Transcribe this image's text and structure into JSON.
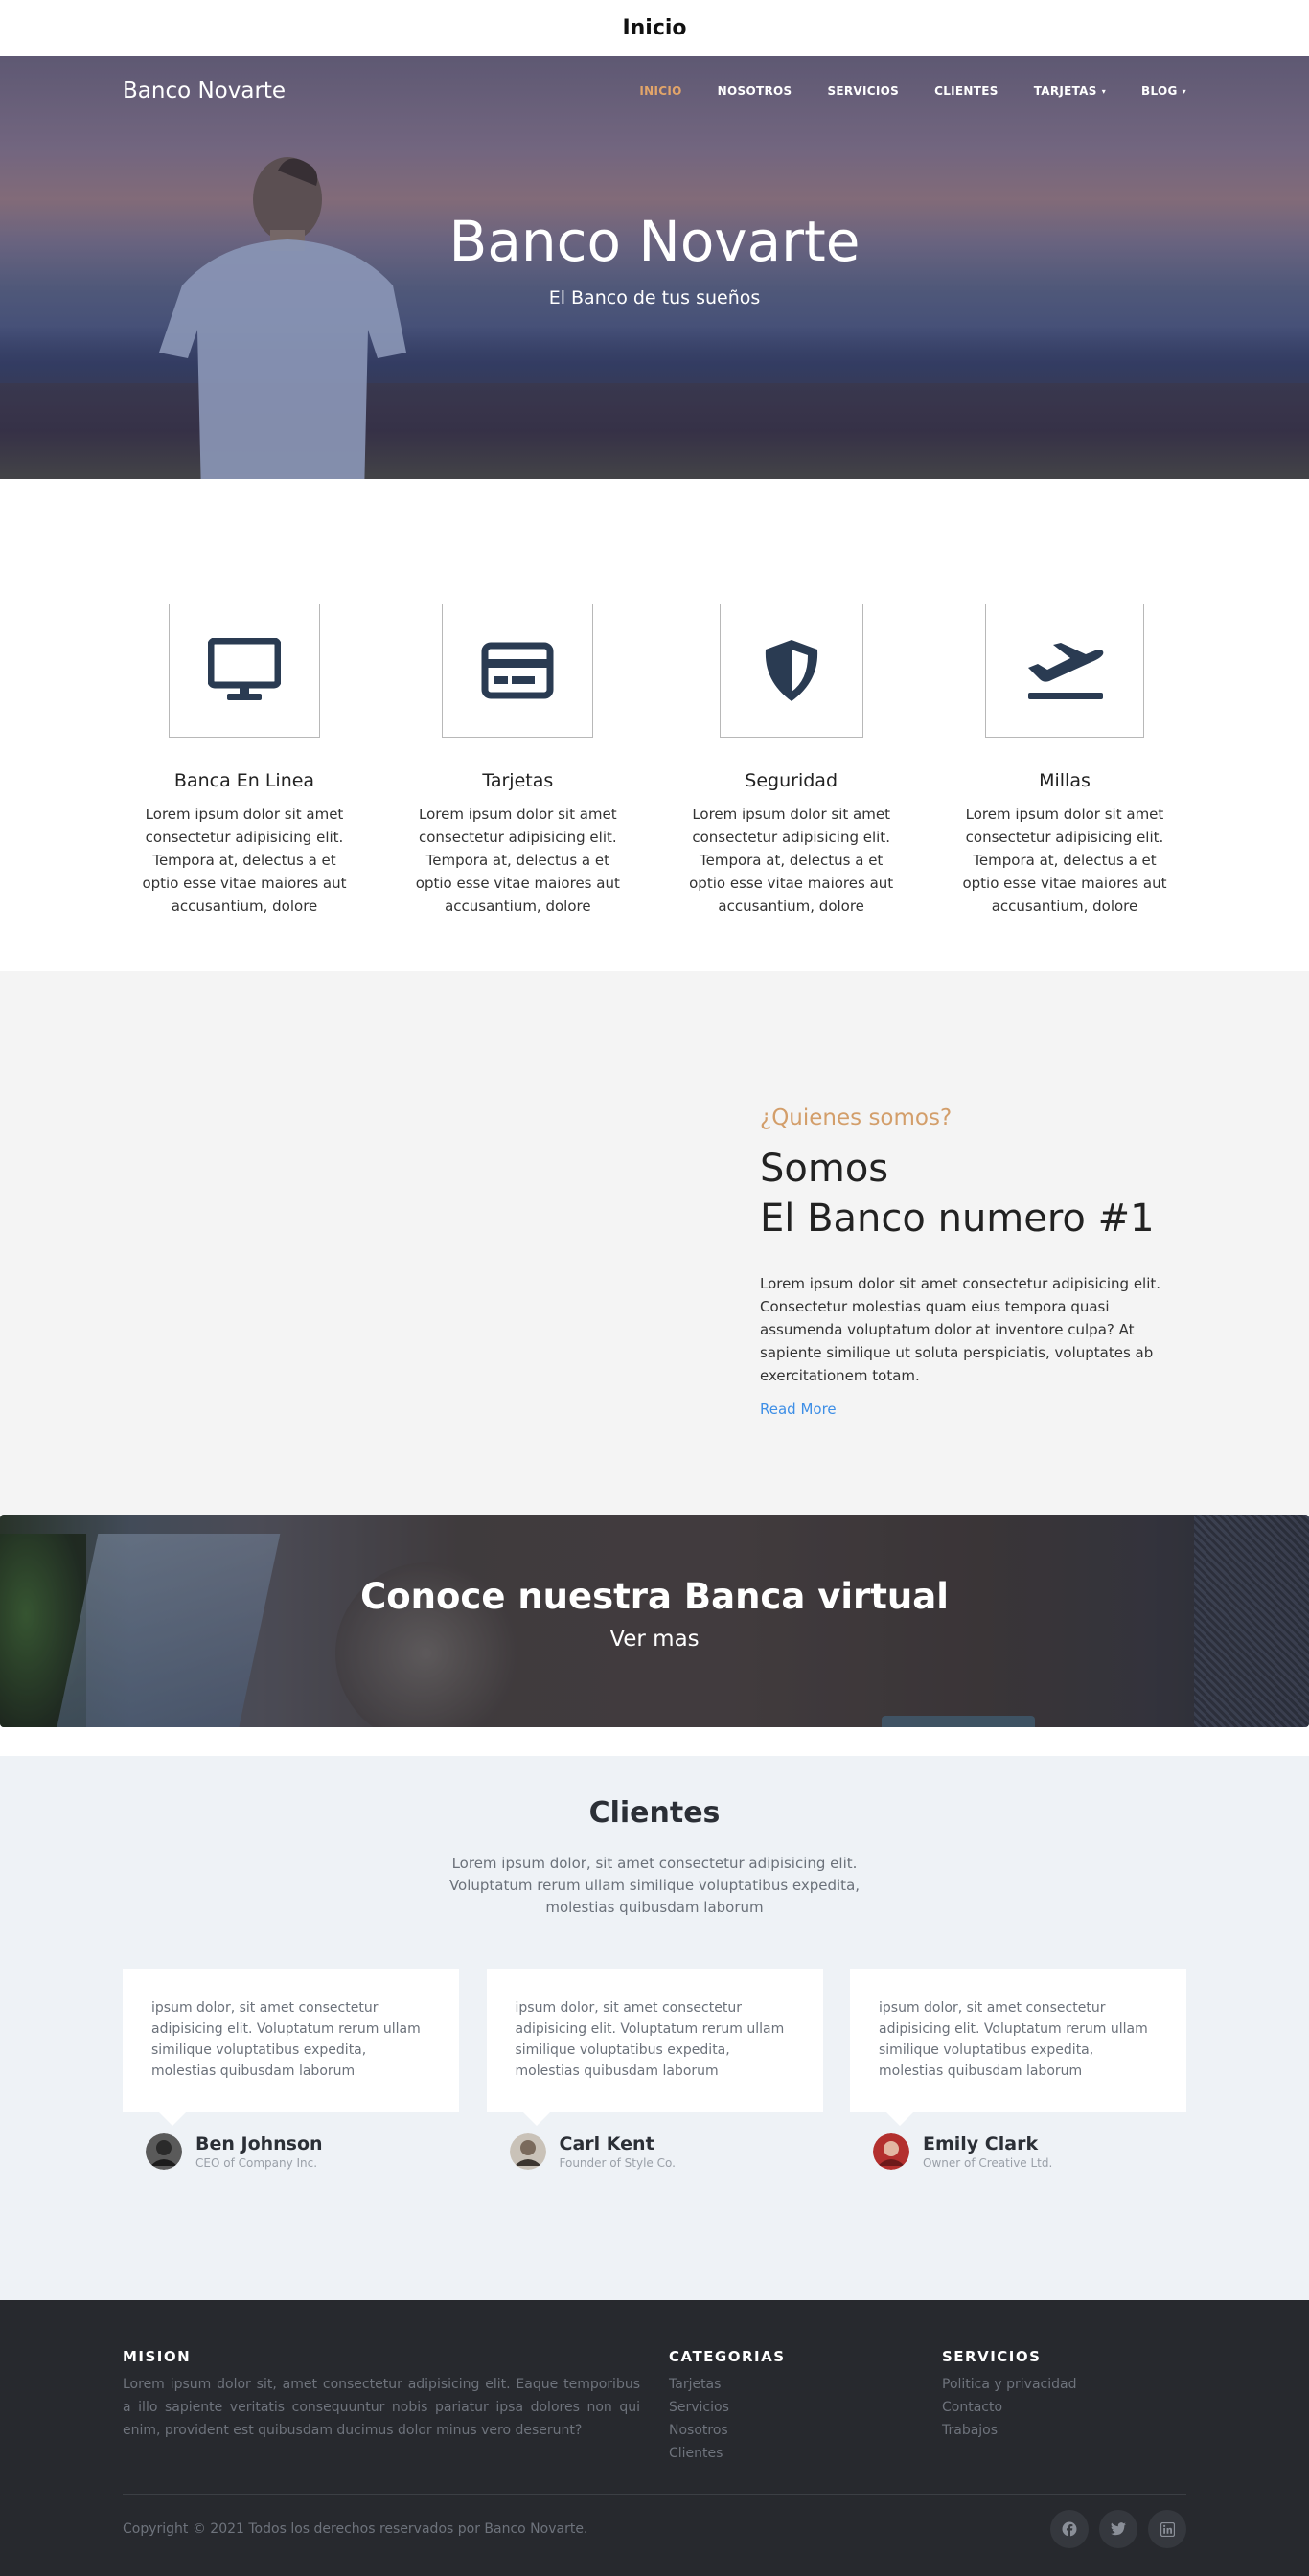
{
  "page_title": "Inicio",
  "nav": {
    "brand": "Banco Novarte",
    "items": [
      {
        "label": "INICIO",
        "active": true
      },
      {
        "label": "NOSOTROS"
      },
      {
        "label": "SERVICIOS"
      },
      {
        "label": "CLIENTES"
      },
      {
        "label": "TARJETAS",
        "caret": "▾"
      },
      {
        "label": "BLOG",
        "caret": "▾"
      }
    ]
  },
  "hero": {
    "title": "Banco Novarte",
    "subtitle": "El Banco de tus sueños"
  },
  "features": [
    {
      "icon": "monitor-icon",
      "title": "Banca En Linea",
      "text": "Lorem ipsum dolor sit amet consectetur adipisicing elit. Tempora at, delectus a et optio esse vitae maiores aut accusantium, dolore"
    },
    {
      "icon": "credit-card-icon",
      "title": "Tarjetas",
      "text": "Lorem ipsum dolor sit amet consectetur adipisicing elit. Tempora at, delectus a et optio esse vitae maiores aut accusantium, dolore"
    },
    {
      "icon": "shield-icon",
      "title": "Seguridad",
      "text": "Lorem ipsum dolor sit amet consectetur adipisicing elit. Tempora at, delectus a et optio esse vitae maiores aut accusantium, dolore"
    },
    {
      "icon": "plane-departure-icon",
      "title": "Millas",
      "text": "Lorem ipsum dolor sit amet consectetur adipisicing elit. Tempora at, delectus a et optio esse vitae maiores aut accusantium, dolore"
    }
  ],
  "about": {
    "kicker": "¿Quienes somos?",
    "heading_line1": "Somos",
    "heading_line2": "El Banco numero #1",
    "text": "Lorem ipsum dolor sit amet consectetur adipisicing elit. Consectetur molestias quam eius tempora quasi assumenda voluptatum dolor at inventore culpa? At sapiente similique ut soluta perspiciatis, voluptates ab exercitationem totam.",
    "link": "Read More"
  },
  "banner": {
    "title": "Conoce nuestra Banca virtual",
    "subtitle": "Ver mas"
  },
  "clients": {
    "title": "Clientes",
    "lead": "Lorem ipsum dolor, sit amet consectetur adipisicing elit. Voluptatum rerum ullam similique voluptatibus expedita, molestias quibusdam laborum",
    "testimonials": [
      {
        "quote": "ipsum dolor, sit amet consectetur adipisicing elit. Voluptatum rerum ullam similique voluptatibus expedita, molestias quibusdam laborum",
        "name": "Ben Johnson",
        "role": "CEO of Company Inc."
      },
      {
        "quote": "ipsum dolor, sit amet consectetur adipisicing elit. Voluptatum rerum ullam similique voluptatibus expedita, molestias quibusdam laborum",
        "name": "Carl Kent",
        "role": "Founder of Style Co."
      },
      {
        "quote": "ipsum dolor, sit amet consectetur adipisicing elit. Voluptatum rerum ullam similique voluptatibus expedita, molestias quibusdam laborum",
        "name": "Emily Clark",
        "role": "Owner of Creative Ltd."
      }
    ]
  },
  "footer": {
    "mision_title": "MISION",
    "mision_text": "Lorem ipsum dolor sit, amet consectetur adipisicing elit. Eaque temporibus a illo sapiente veritatis consequuntur nobis pariatur ipsa dolores non qui enim, provident est quibusdam ducimus dolor minus vero deserunt?",
    "categorias_title": "CATEGORIAS",
    "categorias": [
      "Tarjetas",
      "Servicios",
      "Nosotros",
      "Clientes"
    ],
    "servicios_title": "SERVICIOS",
    "servicios": [
      "Politica y privacidad",
      "Contacto",
      "Trabajos"
    ],
    "copyright": "Copyright © 2021 Todos los derechos reservados por Banco Novarte.",
    "socials": [
      "facebook-icon",
      "twitter-icon",
      "linkedin-icon"
    ]
  },
  "colors": {
    "accent": "#e2a56a",
    "link": "#3d8ee6",
    "icon": "#2a3b52",
    "footer_bg": "#27292e"
  }
}
